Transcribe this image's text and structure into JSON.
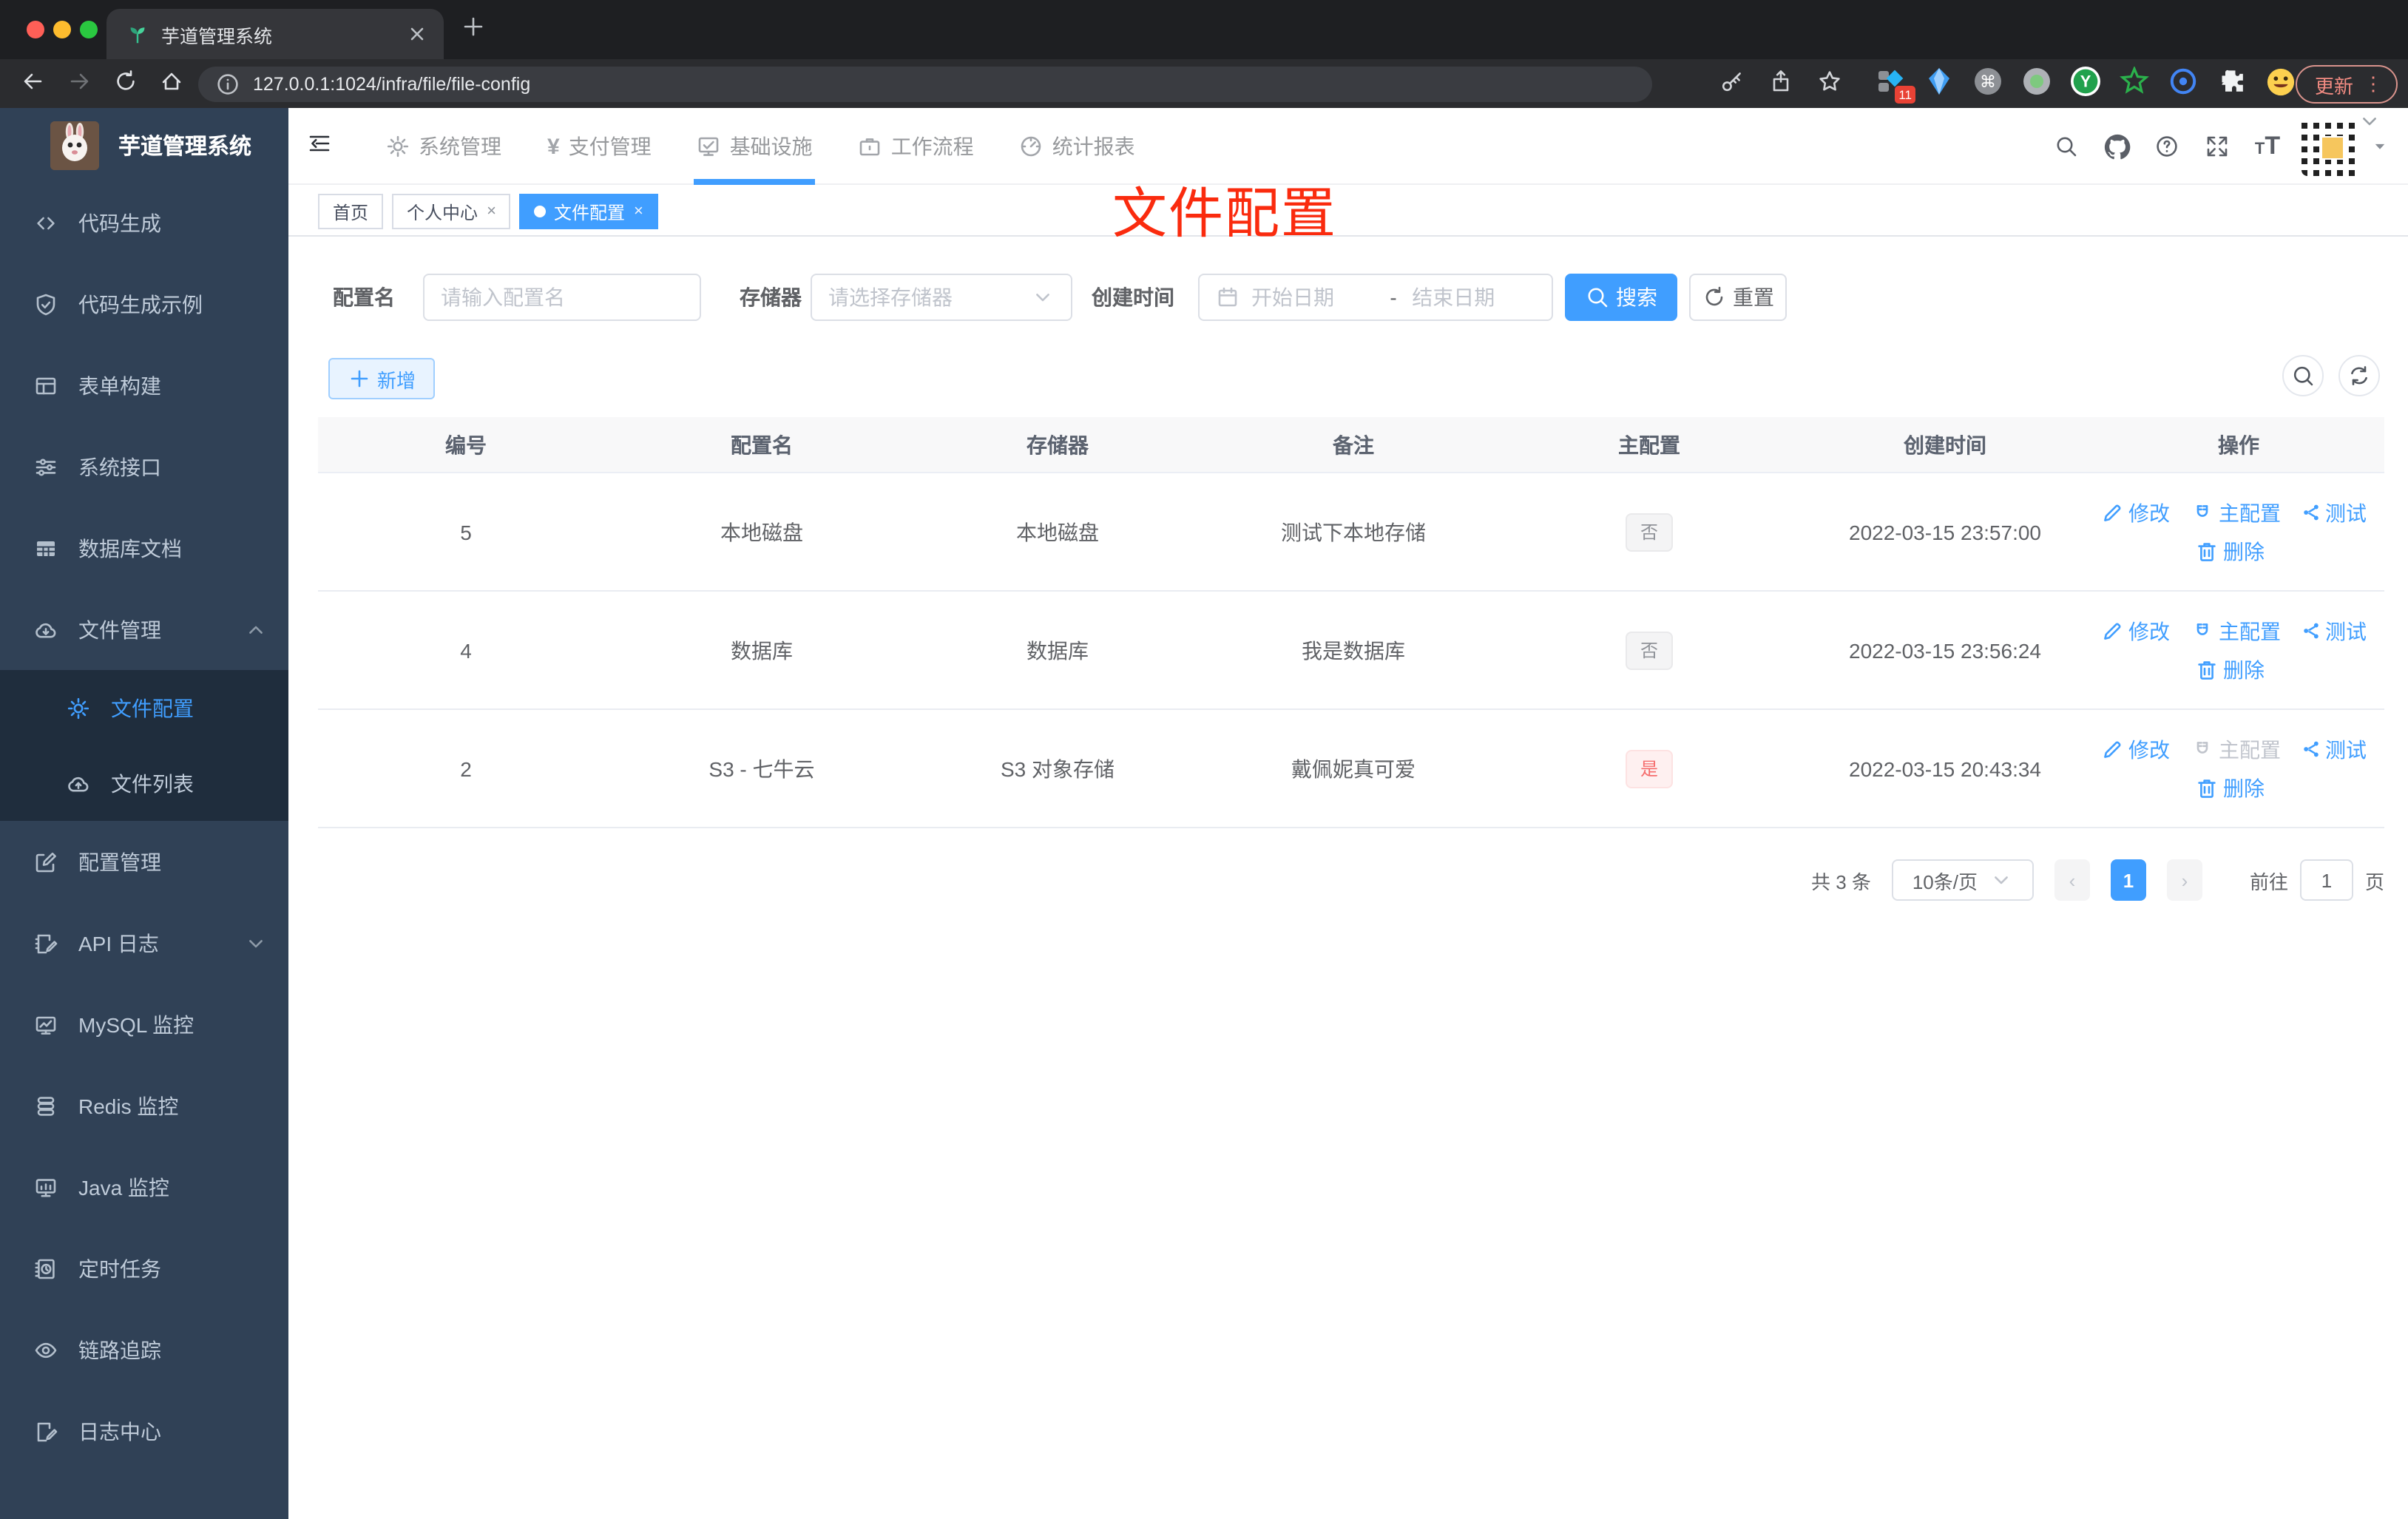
{
  "colors": {
    "primary": "#409eff",
    "sidebar_bg": "#304156",
    "submenu_bg": "#1f2d3d",
    "annotation_red": "#fa2b0e",
    "danger": "#f56c6c"
  },
  "browser": {
    "tab_title": "芋道管理系统",
    "url": "127.0.0.1:1024/infra/file/file-config",
    "update_label": "更新",
    "extensions": [
      {
        "icon": "ext-diamond",
        "badge": "11"
      },
      {
        "icon": "ext-gem"
      },
      {
        "icon": "ext-cmd"
      },
      {
        "icon": "ext-greendot"
      },
      {
        "icon": "ext-ycircle"
      },
      {
        "icon": "ext-star"
      },
      {
        "icon": "ext-rings"
      },
      {
        "icon": "ext-puzzle"
      },
      {
        "icon": "ext-emoji"
      }
    ]
  },
  "sidebar": {
    "logo_title": "芋道管理系统",
    "items": [
      {
        "icon": "code",
        "label": "代码生成"
      },
      {
        "icon": "shield",
        "label": "代码生成示例"
      },
      {
        "icon": "form",
        "label": "表单构建"
      },
      {
        "icon": "sliders",
        "label": "系统接口"
      },
      {
        "icon": "dbdoc",
        "label": "数据库文档"
      },
      {
        "icon": "cloud-down",
        "label": "文件管理",
        "expanded": true,
        "children": [
          {
            "icon": "gear",
            "label": "文件配置",
            "active": true
          },
          {
            "icon": "cloud-up",
            "label": "文件列表"
          }
        ]
      },
      {
        "icon": "edit",
        "label": "配置管理"
      },
      {
        "icon": "apilog",
        "label": "API 日志",
        "collapsed": true
      },
      {
        "icon": "mysql",
        "label": "MySQL 监控"
      },
      {
        "icon": "redis",
        "label": "Redis 监控"
      },
      {
        "icon": "java",
        "label": "Java 监控"
      },
      {
        "icon": "timer",
        "label": "定时任务"
      },
      {
        "icon": "trace",
        "label": "链路追踪"
      },
      {
        "icon": "logcenter",
        "label": "日志中心"
      }
    ]
  },
  "topnav": {
    "items": [
      {
        "icon": "gear",
        "label": "系统管理"
      },
      {
        "icon": "yen",
        "label": "支付管理"
      },
      {
        "icon": "infra",
        "label": "基础设施",
        "active": true
      },
      {
        "icon": "briefcase",
        "label": "工作流程"
      },
      {
        "icon": "gauge",
        "label": "统计报表"
      }
    ]
  },
  "tags": [
    {
      "label": "首页"
    },
    {
      "label": "个人中心",
      "closable": true
    },
    {
      "label": "文件配置",
      "closable": true,
      "active": true
    }
  ],
  "annotation": "文件配置",
  "filters": {
    "name_label": "配置名",
    "name_placeholder": "请输入配置名",
    "storage_label": "存储器",
    "storage_placeholder": "请选择存储器",
    "time_label": "创建时间",
    "start_placeholder": "开始日期",
    "range_separator": "-",
    "end_placeholder": "结束日期",
    "search_label": "搜索",
    "reset_label": "重置"
  },
  "toolbar": {
    "add_label": "新增"
  },
  "table": {
    "columns": [
      "编号",
      "配置名",
      "存储器",
      "备注",
      "主配置",
      "创建时间",
      "操作"
    ],
    "rows": [
      {
        "id": "5",
        "name": "本地磁盘",
        "storage": "本地磁盘",
        "remark": "测试下本地存储",
        "master": "否",
        "master_is_yes": false,
        "created": "2022-03-15 23:57:00",
        "master_action_disabled": false
      },
      {
        "id": "4",
        "name": "数据库",
        "storage": "数据库",
        "remark": "我是数据库",
        "master": "否",
        "master_is_yes": false,
        "created": "2022-03-15 23:56:24",
        "master_action_disabled": false
      },
      {
        "id": "2",
        "name": "S3 - 七牛云",
        "storage": "S3 对象存储",
        "remark": "戴佩妮真可爱",
        "master": "是",
        "master_is_yes": true,
        "created": "2022-03-15 20:43:34",
        "master_action_disabled": true
      }
    ]
  },
  "actions": {
    "edit": "修改",
    "master": "主配置",
    "test": "测试",
    "delete": "删除"
  },
  "pagination": {
    "total": "共 3 条",
    "page_size": "10条/页",
    "prev": "‹",
    "current": "1",
    "next": "›",
    "goto_label": "前往",
    "goto_value": "1",
    "page_unit": "页"
  }
}
